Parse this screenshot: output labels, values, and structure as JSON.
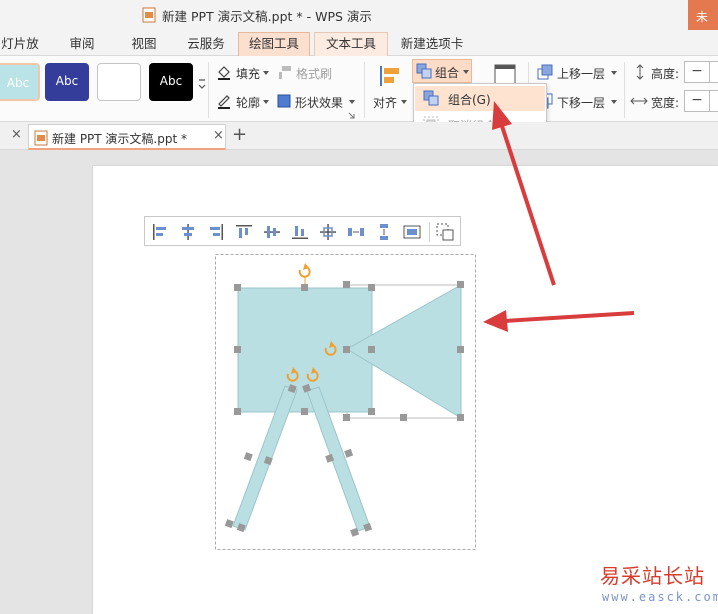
{
  "window": {
    "title": "新建 PPT 演示文稿.ppt * - WPS 演示",
    "login_label": "未"
  },
  "menu": {
    "tabs": [
      {
        "label": "灯片放映"
      },
      {
        "label": "审阅"
      },
      {
        "label": "视图"
      },
      {
        "label": "云服务"
      },
      {
        "label": "绘图工具"
      },
      {
        "label": "文本工具"
      },
      {
        "label": "新建选项卡"
      }
    ]
  },
  "ribbon": {
    "styles": [
      "Abc",
      "Abc",
      "",
      "Abc"
    ],
    "fill_label": "填充",
    "format_brush_label": "格式刷",
    "outline_label": "轮廓",
    "shape_effect_label": "形状效果",
    "align_label": "对齐",
    "group_label": "组合",
    "move_up_label": "上移一层",
    "move_down_label": "下移一层",
    "height_label": "高度:",
    "width_label": "宽度:",
    "minus_glyph": "−"
  },
  "group_menu": {
    "items": [
      {
        "label": "组合(G)",
        "enabled": true
      },
      {
        "label": "取消组合(",
        "enabled": false
      }
    ]
  },
  "doc_tabs": {
    "tab_label": "新建 PPT 演示文稿.ppt *",
    "close_glyph": "×",
    "add_glyph": "+"
  },
  "watermark": {
    "chinese": "易采站长站",
    "url": "www.easck.com"
  },
  "colors": {
    "accent": "#e4794f",
    "shape_fill": "#b9dfe2",
    "shape_stroke": "#9cc5cb",
    "handle": "#999999",
    "rotate_handle": "#f0a030",
    "arrow_red": "#d93c3c"
  }
}
